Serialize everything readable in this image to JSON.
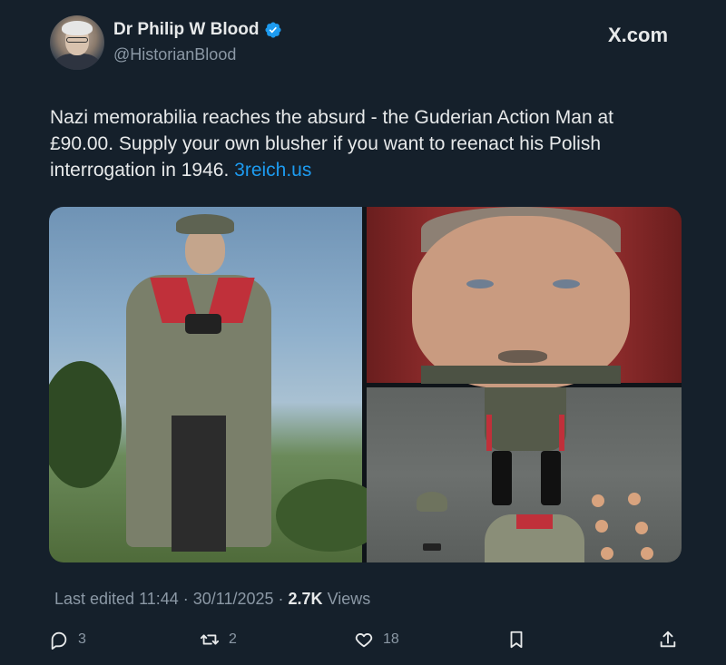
{
  "author": {
    "display_name": "Dr Philip W Blood",
    "handle": "@HistorianBlood",
    "verified_icon": "verified-badge-icon"
  },
  "source": "X.com",
  "tweet": {
    "text": "Nazi memorabilia reaches the absurd - the Guderian Action Man at £90.00. Supply your own blusher if you want to reenact his Polish interrogation in 1946. ",
    "link": "3reich.us"
  },
  "meta": {
    "edited": "Last edited 11:44 · 30/11/2025",
    "separator": " · ",
    "views_count": "2.7K",
    "views_label": " Views"
  },
  "actions": {
    "replies": "3",
    "reposts": "2",
    "likes": "18"
  },
  "colors": {
    "background": "#15202b",
    "text": "#e7e9ea",
    "muted": "#8b98a5",
    "link": "#1d9bf0"
  }
}
